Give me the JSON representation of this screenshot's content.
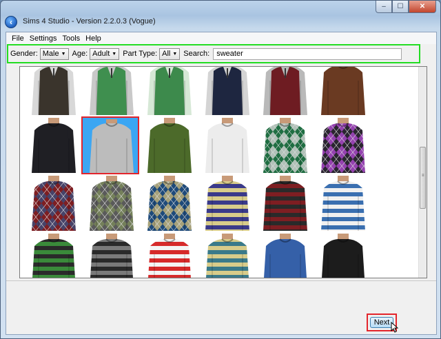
{
  "window": {
    "title": "Sims 4 Studio - Version 2.2.0.3  (Vogue)",
    "controls": {
      "minimize": "–",
      "maximize": "☐",
      "close": "✕"
    }
  },
  "menu": [
    "File",
    "Settings",
    "Tools",
    "Help"
  ],
  "filters": {
    "gender_label": "Gender:",
    "gender_value": "Male",
    "age_label": "Age:",
    "age_value": "Adult",
    "part_type_label": "Part Type:",
    "part_type_value": "All",
    "search_label": "Search:",
    "search_value": "sweater"
  },
  "items": [
    {
      "style": "vest",
      "body": "#3a342c",
      "accent": "#d8d8d8",
      "stripe": null
    },
    {
      "style": "vest",
      "body": "#3f8f4f",
      "accent": "#c9c9c9",
      "stripe": null
    },
    {
      "style": "vest",
      "body": "#3d8a4c",
      "accent": "#d6e8d6",
      "stripe": null
    },
    {
      "style": "vest",
      "body": "#1e2640",
      "accent": "#d4d4d4",
      "stripe": null
    },
    {
      "style": "vest",
      "body": "#6e1c22",
      "accent": "#b9b9b9",
      "stripe": null
    },
    {
      "style": "plain",
      "body": "#6a3a22",
      "accent": "#6a3a22",
      "stripe": null
    },
    {
      "style": "plain",
      "body": "#1f1f24",
      "accent": "#1f1f24",
      "stripe": null
    },
    {
      "style": "plain",
      "body": "#bcbcbc",
      "accent": "#bcbcbc",
      "stripe": null
    },
    {
      "style": "plain",
      "body": "#4c6a2a",
      "accent": "#4c6a2a",
      "stripe": null
    },
    {
      "style": "plain",
      "body": "#ececec",
      "accent": "#ececec",
      "stripe": null
    },
    {
      "style": "argyle",
      "body": "#1f6e42",
      "accent": "#d6d6d6",
      "stripe": null
    },
    {
      "style": "argyle",
      "body": "#2a2530",
      "accent": "#b04ad0",
      "stripe": null
    },
    {
      "style": "argyle",
      "body": "#7e1e22",
      "accent": "#3a4c7a",
      "stripe": null
    },
    {
      "style": "argyle",
      "body": "#5a5a5a",
      "accent": "#7b8a5a",
      "stripe": null
    },
    {
      "style": "argyle",
      "body": "#1e4a7a",
      "accent": "#c8b77a",
      "stripe": null
    },
    {
      "style": "striped",
      "body": "#3a3a8a",
      "accent": "#d8cc8a",
      "stripe": "#3a3a8a"
    },
    {
      "style": "striped",
      "body": "#7e1e22",
      "accent": "#2a2a2a",
      "stripe": "#7e1e22"
    },
    {
      "style": "striped",
      "body": "#3a6fb0",
      "accent": "#f0f0f0",
      "stripe": "#3a6fb0"
    },
    {
      "style": "striped",
      "body": "#3a8a3a",
      "accent": "#2a2a2a",
      "stripe": "#3a8a3a"
    },
    {
      "style": "striped",
      "body": "#2a2a2a",
      "accent": "#7a7a7a",
      "stripe": "#2a2a2a"
    },
    {
      "style": "striped",
      "body": "#d62a2a",
      "accent": "#f4f4f4",
      "stripe": "#d62a2a"
    },
    {
      "style": "striped",
      "body": "#3a7a8a",
      "accent": "#d8cc8a",
      "stripe": "#3a7a8a"
    },
    {
      "style": "plain",
      "body": "#3560a8",
      "accent": "#3560a8",
      "stripe": null
    },
    {
      "style": "plain",
      "body": "#1c1c1c",
      "accent": "#1c1c1c",
      "stripe": null
    }
  ],
  "selected_index": 7,
  "colors": {
    "filter_border": "#22dd22",
    "highlight": "#e3242b",
    "selected_bg": "#3ba6f3"
  },
  "icons": {
    "back": "back-arrow-icon",
    "cursor": "mouse-pointer-icon"
  },
  "footer": {
    "next_label": "Next"
  }
}
